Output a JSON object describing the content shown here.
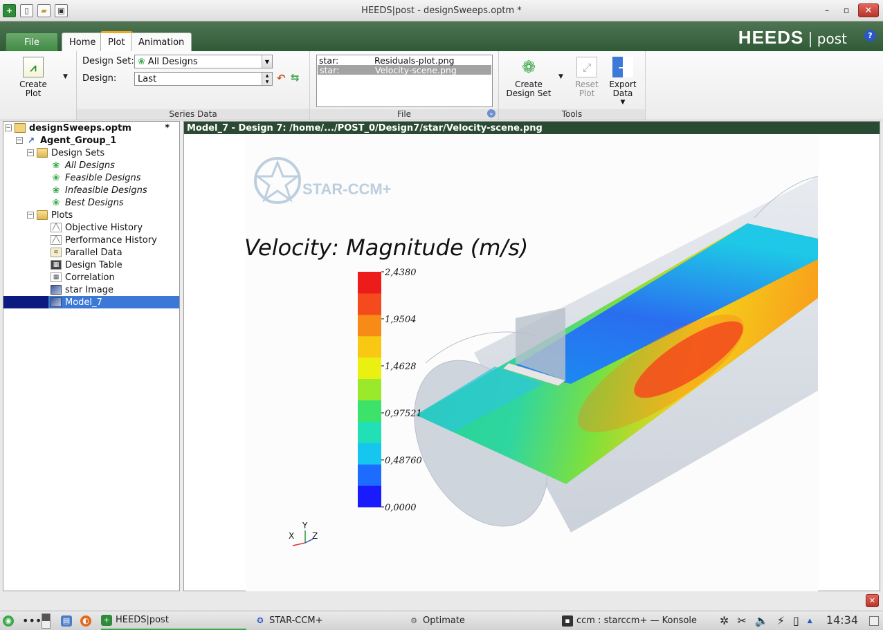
{
  "window": {
    "title": "HEEDS|post - designSweeps.optm *",
    "minimize": "–",
    "restore": "▫",
    "close": "✕"
  },
  "quick_access": {
    "app_icon": "plus-icon",
    "new_icon": "new-document-icon",
    "open_icon": "open-folder-icon",
    "save_icon": "save-icon"
  },
  "ribbon_tabs": [
    "File",
    "Home",
    "Plot",
    "Animation"
  ],
  "active_tab": "Plot",
  "brand": {
    "name": "HEEDS",
    "separator": "|",
    "product": "post",
    "help": "?"
  },
  "ribbon": {
    "create_plot": {
      "label_line1": "Create",
      "label_line2": "Plot"
    },
    "series_data": {
      "group_label": "Series Data",
      "design_set_label": "Design Set:",
      "design_set_value": "All Designs",
      "design_label": "Design:",
      "design_value": "Last"
    },
    "file": {
      "group_label": "File",
      "rows": [
        {
          "source": "star:",
          "name": "Residuals-plot.png",
          "selected": false
        },
        {
          "source": "star:",
          "name": "Velocity-scene.png",
          "selected": true
        }
      ]
    },
    "tools": {
      "group_label": "Tools",
      "create_design_set": {
        "label_line1": "Create",
        "label_line2": "Design Set"
      },
      "reset_plot": {
        "label_line1": "Reset",
        "label_line2": "Plot"
      },
      "export_data": {
        "label_line1": "Export",
        "label_line2": "Data"
      }
    }
  },
  "tree": {
    "root": {
      "label": "designSweeps.optm",
      "modified": "*"
    },
    "agent_group": "Agent_Group_1",
    "design_sets_folder": "Design Sets",
    "design_sets": [
      "All Designs",
      "Feasible Designs",
      "Infeasible Designs",
      "Best Designs"
    ],
    "plots_folder": "Plots",
    "plots": [
      "Objective History",
      "Performance History",
      "Parallel Data",
      "Design Table",
      "Correlation",
      "star Image",
      "Model_7"
    ],
    "selected": "Model_7"
  },
  "viewer": {
    "header": "Model_7 - Design 7: /home/.../POST_0/Design7/star/Velocity-scene.png",
    "scene": {
      "logo_text": "STAR-CCM+",
      "title": "Velocity: Magnitude (m/s)",
      "colorbar_ticks": [
        "2,4380",
        "1,9504",
        "1,4628",
        "0,97521",
        "0,48760",
        "0,0000"
      ],
      "colorbar_fractions": [
        1.0,
        0.8,
        0.6,
        0.4,
        0.2,
        0.0
      ],
      "colorbar_colors": [
        "#1a1aff",
        "#1e6cff",
        "#16c6ef",
        "#22e0b6",
        "#3ce26a",
        "#9ae92b",
        "#e9f012",
        "#f8c812",
        "#f88a18",
        "#f44a1e",
        "#ee1b1b"
      ],
      "axis_labels": {
        "x": "X",
        "y": "Y",
        "z": "Z"
      }
    }
  },
  "taskbar": {
    "items": [
      {
        "label": "HEEDS|post",
        "icon": "heeds-icon",
        "active": true
      },
      {
        "label": "STAR-CCM+",
        "icon": "star-ccm-icon",
        "active": false
      },
      {
        "label": "Optimate",
        "icon": "gear-icon",
        "active": false
      },
      {
        "label": "ccm : starccm+ — Konsole",
        "icon": "terminal-icon",
        "active": false
      }
    ],
    "clock": "14:34"
  }
}
